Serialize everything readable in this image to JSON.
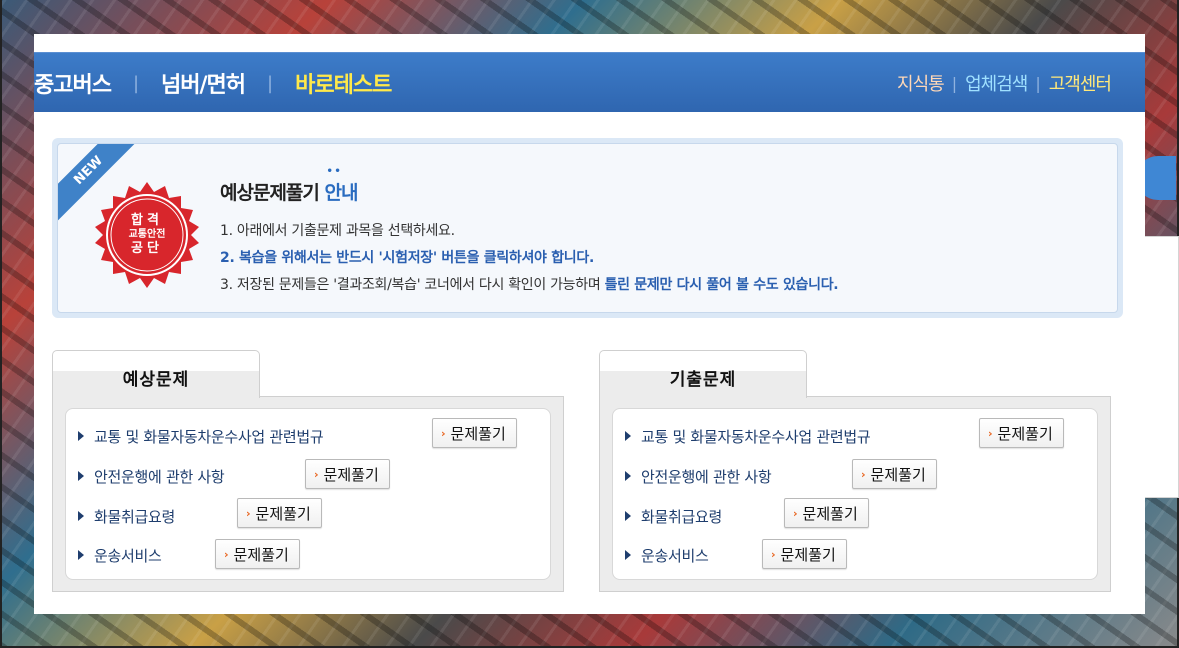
{
  "nav": {
    "items": [
      {
        "label": "중고버스",
        "active": false
      },
      {
        "label": "넘버/면허",
        "active": false
      },
      {
        "label": "바로테스트",
        "active": true
      }
    ],
    "right_links": [
      "지식통",
      "업체검색",
      "고객센터"
    ],
    "separator": "|"
  },
  "notice": {
    "ribbon": "NEW",
    "seal": {
      "line1": "합격",
      "line2": "교통안전",
      "line3": "공단"
    },
    "title_main": "예상문제풀기",
    "title_highlight": "안내",
    "line1": "1. 아래에서 기출문제 과목을 선택하세요.",
    "line2": "2. 복습을 위해서는 반드시 '시험저장' 버튼을 클릭하셔야 합니다.",
    "line3_prefix": "3. 저장된 문제들은 '결과조회/복습' 코너에서 다시 확인이 가능하며 ",
    "line3_strong": "틀린 문제만 다시 풀어 볼 수도 있습니다."
  },
  "sections": [
    {
      "tab": "예상문제",
      "items": [
        {
          "label": "교통 및 화물자동차운수사업 관련법규",
          "button": "문제풀기"
        },
        {
          "label": "안전운행에 관한 사항",
          "button": "문제풀기"
        },
        {
          "label": "화물취급요령",
          "button": "문제풀기"
        },
        {
          "label": "운송서비스",
          "button": "문제풀기"
        }
      ]
    },
    {
      "tab": "기출문제",
      "items": [
        {
          "label": "교통 및 화물자동차운수사업 관련법규",
          "button": "문제풀기"
        },
        {
          "label": "안전운행에 관한 사항",
          "button": "문제풀기"
        },
        {
          "label": "화물취급요령",
          "button": "문제풀기"
        },
        {
          "label": "운송서비스",
          "button": "문제풀기"
        }
      ]
    }
  ],
  "icons": {
    "bullet": "triangle-right-icon",
    "button_chevron": "chevron-right-icon"
  },
  "colors": {
    "nav_bg": "#3574c2",
    "nav_active": "#ffe94a",
    "link_blue": "#1f3e6e",
    "emphasis_blue": "#2a5fb0",
    "seal_red": "#d8262c",
    "button_chevron": "#e8641e"
  }
}
